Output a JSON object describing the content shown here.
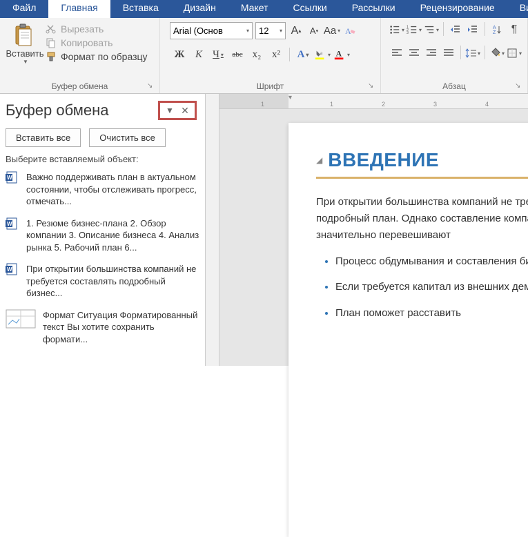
{
  "tabs": {
    "file": "Файл",
    "home": "Главная",
    "insert": "Вставка",
    "design": "Дизайн",
    "layout": "Макет",
    "references": "Ссылки",
    "mailings": "Рассылки",
    "review": "Рецензирование",
    "view": "Вид"
  },
  "ribbon": {
    "clipboard": {
      "paste": "Вставить",
      "cut": "Вырезать",
      "copy": "Копировать",
      "format_painter": "Формат по образцу",
      "group_label": "Буфер обмена"
    },
    "font": {
      "name": "Arial (Основ",
      "size": "12",
      "group_label": "Шрифт",
      "bold": "Ж",
      "italic": "К",
      "underline": "Ч",
      "strike": "abc",
      "sub": "x₂",
      "sup": "x²",
      "aa_case": "Aa"
    },
    "paragraph": {
      "group_label": "Абзац"
    }
  },
  "clipboard_pane": {
    "title": "Буфер обмена",
    "paste_all": "Вставить все",
    "clear_all": "Очистить все",
    "hint": "Выберите вставляемый объект:",
    "items": [
      "Важно поддерживать план в актуальном состоянии, чтобы отслеживать прогресс, отмечать...",
      "1. Резюме бизнес-плана 2. Обзор компании 3. Описание бизнеса 4. Анализ рынка 5. Рабочий план 6...",
      "При открытии большинства компаний не требуется составлять подробный бизнес...",
      "Формат Ситуация Форматированный текст Вы хотите сохранить формати..."
    ]
  },
  "document": {
    "heading": "ВВЕДЕНИЕ",
    "para": "При открытии большинства компаний не требуется составлять подробный план. Однако составление компаний не требуется которые значительно перевешивают",
    "bullets": [
      "Процесс обдумывания и составления бизнеса.",
      "Если требуется капитал из внешних демонстрирующий хорошее",
      "План поможет расставить"
    ]
  },
  "ruler": {
    "marks": [
      "1",
      "1",
      "2",
      "3",
      "4"
    ]
  }
}
